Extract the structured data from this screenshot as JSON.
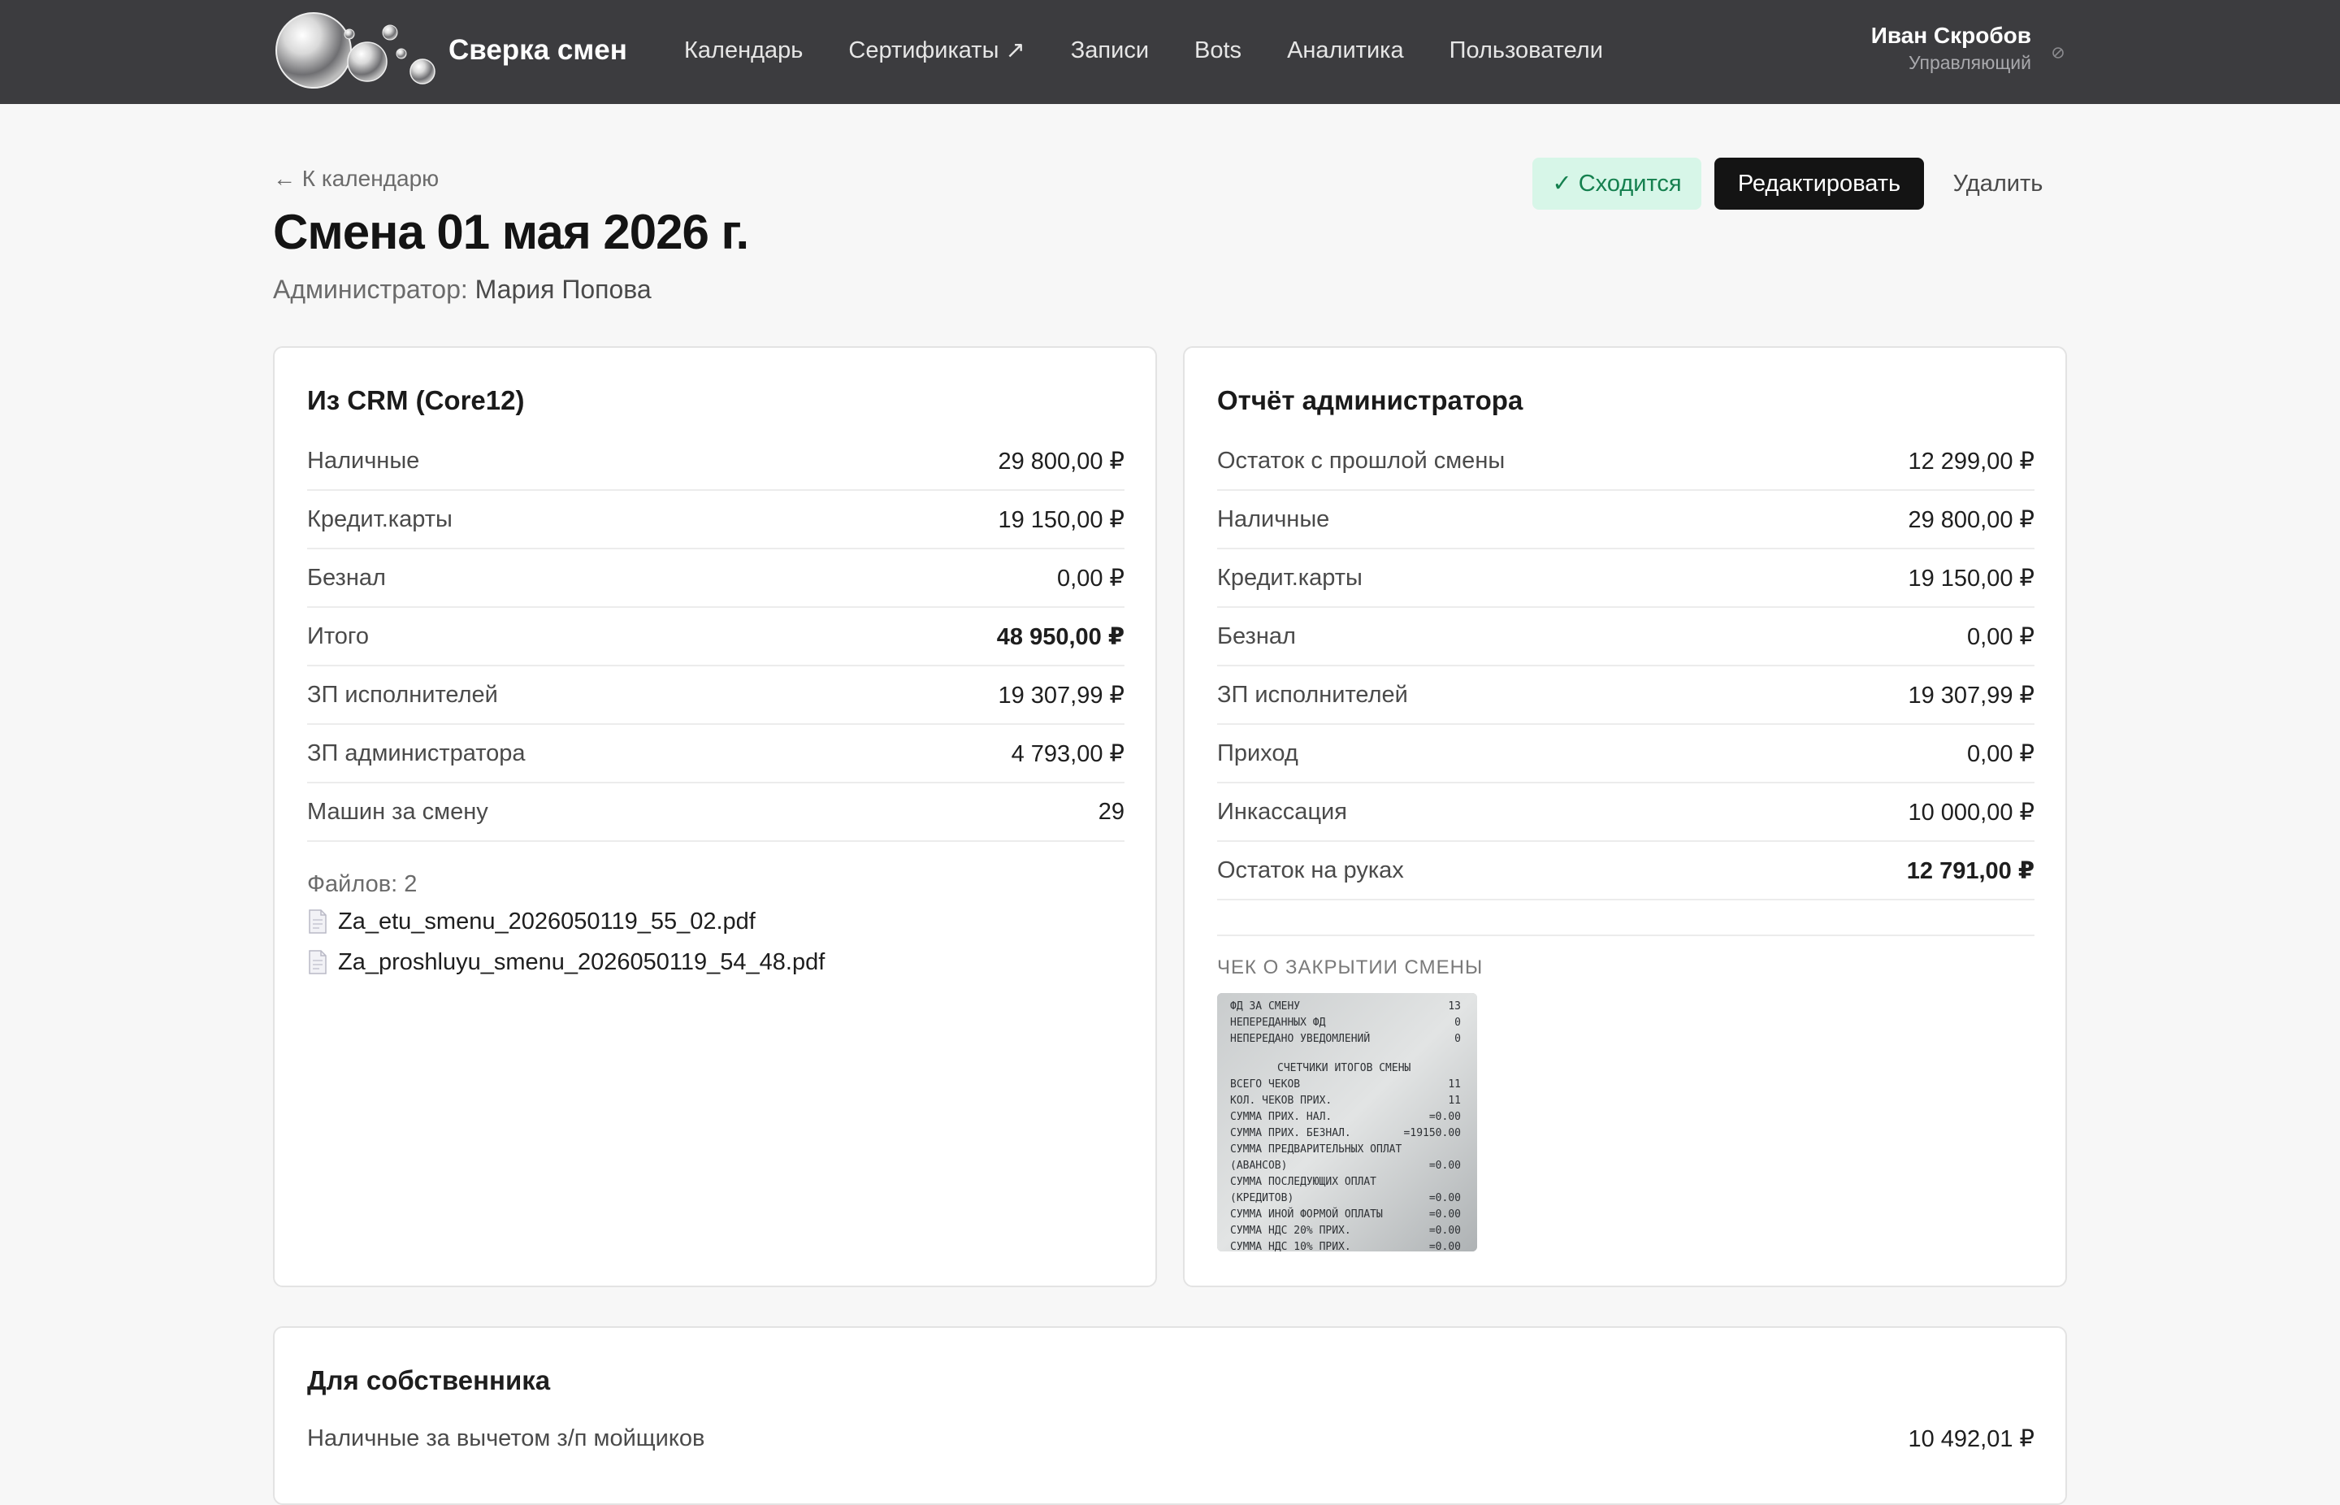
{
  "header": {
    "brand": "Сверка смен",
    "nav": [
      {
        "label": "Календарь"
      },
      {
        "label": "Сертификаты ↗"
      },
      {
        "label": "Записи"
      },
      {
        "label": "Bots"
      },
      {
        "label": "Аналитика"
      },
      {
        "label": "Пользователи"
      }
    ],
    "user": {
      "name": "Иван Скробов",
      "role": "Управляющий"
    }
  },
  "page": {
    "back_link": "← К календарю",
    "title": "Смена 01 мая 2026 г.",
    "admin_label": "Администратор:",
    "admin_name": "Мария Попова",
    "status_badge": "✓ Сходится",
    "edit_button": "Редактировать",
    "delete_button": "Удалить"
  },
  "crm": {
    "title": "Из CRM (Core12)",
    "rows": [
      {
        "label": "Наличные",
        "value": "29 800,00 ₽"
      },
      {
        "label": "Кредит.карты",
        "value": "19 150,00 ₽"
      },
      {
        "label": "Безнал",
        "value": "0,00 ₽"
      },
      {
        "label": "Итого",
        "value": "48 950,00 ₽"
      },
      {
        "label": "ЗП исполнителей",
        "value": "19 307,99 ₽"
      },
      {
        "label": "ЗП администратора",
        "value": "4 793,00 ₽"
      },
      {
        "label": "Машин за смену",
        "value": "29"
      }
    ],
    "files_count": "Файлов: 2",
    "files": [
      {
        "name": "Za_etu_smenu_2026050119_55_02.pdf"
      },
      {
        "name": "Za_proshluyu_smenu_2026050119_54_48.pdf"
      }
    ]
  },
  "admin_report": {
    "title": "Отчёт администратора",
    "rows": [
      {
        "label": "Остаток с прошлой смены",
        "value": "12 299,00 ₽"
      },
      {
        "label": "Наличные",
        "value": "29 800,00 ₽"
      },
      {
        "label": "Кредит.карты",
        "value": "19 150,00 ₽"
      },
      {
        "label": "Безнал",
        "value": "0,00 ₽"
      },
      {
        "label": "ЗП исполнителей",
        "value": "19 307,99 ₽"
      },
      {
        "label": "Приход",
        "value": "0,00 ₽"
      },
      {
        "label": "Инкассация",
        "value": "10 000,00 ₽"
      },
      {
        "label": "Остаток на руках",
        "value": "12 791,00 ₽"
      }
    ],
    "receipt_label": "ЧЕК О ЗАКРЫТИИ СМЕНЫ",
    "receipt_lines": [
      {
        "text": "ФД ЗА СМЕНУ",
        "value": "13"
      },
      {
        "text": "НЕПЕРЕДАННЫХ ФД",
        "value": "0"
      },
      {
        "text": "НЕПЕРЕДАНО УВЕДОМЛЕНИЙ",
        "value": "0"
      },
      {
        "text": "СЧЕТЧИКИ ИТОГОВ СМЕНЫ",
        "value": ""
      },
      {
        "text": "ВСЕГО ЧЕКОВ",
        "value": "11"
      },
      {
        "text": "КОЛ. ЧЕКОВ ПРИХ.",
        "value": "11"
      },
      {
        "text": "СУММА ПРИХ. НАЛ.",
        "value": "=0.00"
      },
      {
        "text": "СУММА ПРИХ. БЕЗНАЛ.",
        "value": "=19150.00"
      },
      {
        "text": "СУММА ПРЕДВАРИТЕЛЬНЫХ ОПЛАТ",
        "value": ""
      },
      {
        "text": "(АВАНСОВ)",
        "value": "=0.00"
      },
      {
        "text": "СУММА ПОСЛЕДУЮЩИХ ОПЛАТ",
        "value": ""
      },
      {
        "text": "(КРЕДИТОВ)",
        "value": "=0.00"
      },
      {
        "text": "СУММА ИНОЙ ФОРМОЙ ОПЛАТЫ",
        "value": "=0.00"
      },
      {
        "text": "СУММА НДС 20% ПРИХ.",
        "value": "=0.00"
      },
      {
        "text": "СУММА НДС 10% ПРИХ.",
        "value": "=0.00"
      }
    ]
  },
  "owner": {
    "title": "Для собственника",
    "rows": [
      {
        "label": "Наличные за вычетом з/п мойщиков",
        "value": "10 492,01 ₽"
      }
    ]
  },
  "colors": {
    "topbar": "#3c3c3f",
    "status_ok_bg": "#d7f6e8",
    "status_ok_text": "#15804f",
    "primary_button": "#141414"
  }
}
